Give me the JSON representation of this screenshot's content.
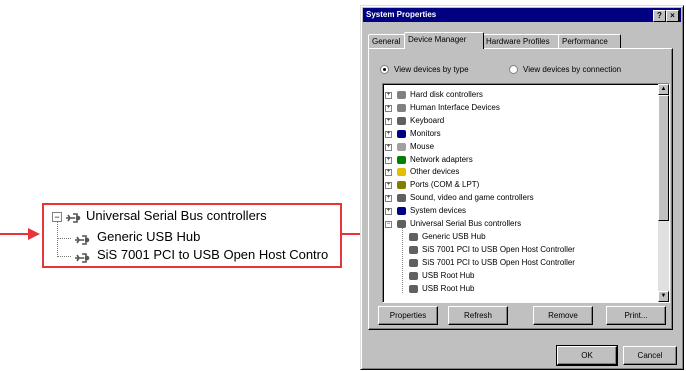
{
  "callout": {
    "items": [
      {
        "label": "Universal Serial Bus controllers"
      },
      {
        "label": "Generic USB Hub"
      },
      {
        "label": "SiS 7001 PCI to USB Open Host Contro"
      }
    ]
  },
  "dialog": {
    "title": "System Properties",
    "title_buttons": {
      "help": "?",
      "close": "×"
    },
    "tabs": [
      {
        "label": "General"
      },
      {
        "label": "Device Manager"
      },
      {
        "label": "Hardware Profiles"
      },
      {
        "label": "Performance"
      }
    ],
    "radios": {
      "by_type": "View devices by type",
      "by_connection": "View devices by connection"
    },
    "tree": [
      {
        "label": "Hard disk controllers",
        "icon": "disk-controller-icon",
        "color": "#808080"
      },
      {
        "label": "Human Interface Devices",
        "icon": "hid-icon",
        "color": "#808080"
      },
      {
        "label": "Keyboard",
        "icon": "keyboard-icon",
        "color": "#606060"
      },
      {
        "label": "Monitors",
        "icon": "monitor-icon",
        "color": "#000080"
      },
      {
        "label": "Mouse",
        "icon": "mouse-icon",
        "color": "#a0a0a0"
      },
      {
        "label": "Network adapters",
        "icon": "network-adapter-icon",
        "color": "#008000"
      },
      {
        "label": "Other devices",
        "icon": "question-icon",
        "color": "#e0c000"
      },
      {
        "label": "Ports (COM & LPT)",
        "icon": "port-icon",
        "color": "#808000"
      },
      {
        "label": "Sound, video and game controllers",
        "icon": "sound-icon",
        "color": "#606060"
      },
      {
        "label": "System devices",
        "icon": "system-device-icon",
        "color": "#000080"
      },
      {
        "label": "Universal Serial Bus controllers",
        "icon": "usb-icon",
        "color": "#606060"
      },
      {
        "label": "Generic USB Hub",
        "icon": "usb-device-icon",
        "color": "#606060"
      },
      {
        "label": "SiS 7001 PCI to USB Open Host Controller",
        "icon": "usb-device-icon",
        "color": "#606060"
      },
      {
        "label": "SiS 7001 PCI to USB Open Host Controller",
        "icon": "usb-device-icon",
        "color": "#606060"
      },
      {
        "label": "USB Root Hub",
        "icon": "usb-device-icon",
        "color": "#606060"
      },
      {
        "label": "USB Root Hub",
        "icon": "usb-device-icon",
        "color": "#606060"
      }
    ],
    "buttons": {
      "properties": "Properties",
      "refresh": "Refresh",
      "remove": "Remove",
      "print": "Print...",
      "ok": "OK",
      "cancel": "Cancel"
    },
    "colors": {
      "title_bar": "#000080",
      "face": "#c0c0c0",
      "callout_red": "#e8333a"
    }
  }
}
